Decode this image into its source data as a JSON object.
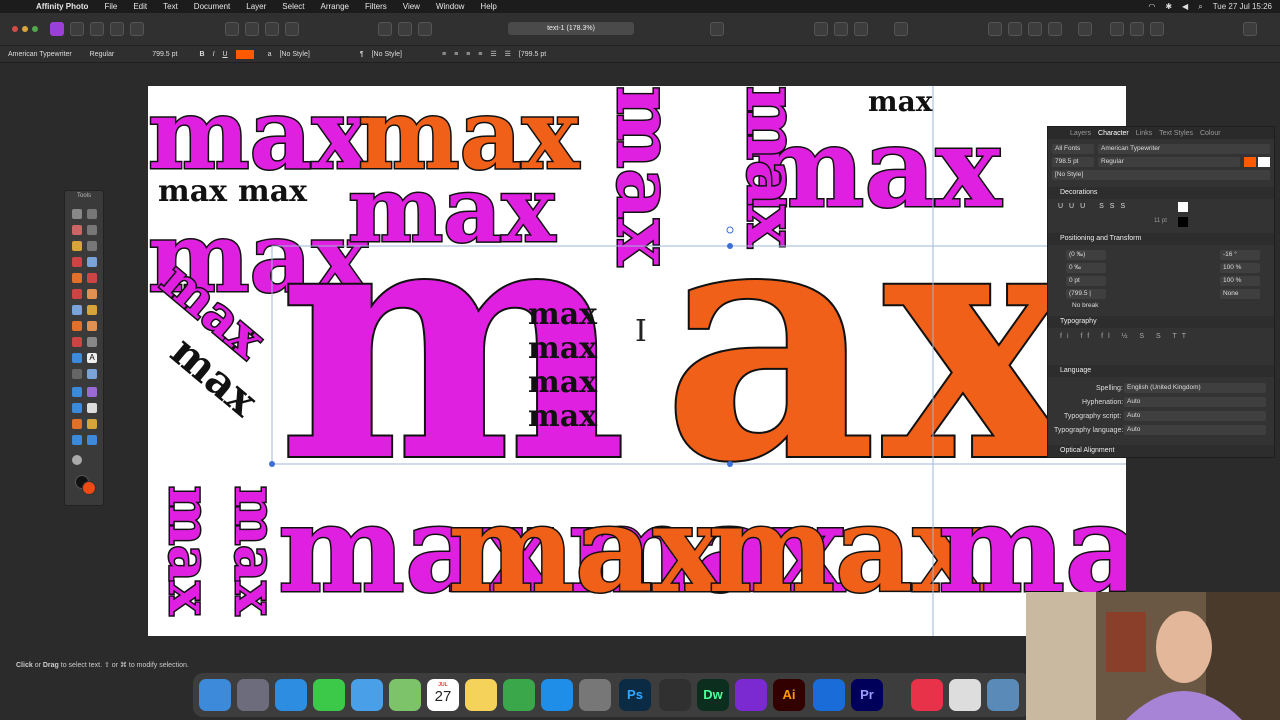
{
  "menubar": {
    "app_name": "Affinity Photo",
    "items": [
      "File",
      "Edit",
      "Text",
      "Document",
      "Layer",
      "Select",
      "Arrange",
      "Filters",
      "View",
      "Window",
      "Help"
    ],
    "clock": "Tue 27 Jul  15:26"
  },
  "toolbar": {
    "doc_title": "text-1 (178.3%)"
  },
  "context_bar": {
    "font": "American Typewriter",
    "weight": "Regular",
    "size": "799.5 pt",
    "bold": "B",
    "italic": "I",
    "underline": "U",
    "para_style": "[No Style]",
    "char_style": "[No Style]",
    "leading_size": "[799.5 pt",
    "fill_color": "#ff5a00"
  },
  "tools_panel": {
    "title": "Tools"
  },
  "canvas": {
    "word": "max",
    "colors": {
      "magenta": "#e020e0",
      "orange": "#f06018",
      "black": "#111111"
    }
  },
  "character_panel": {
    "tabs": [
      "Layers",
      "Character",
      "Links",
      "Text Styles",
      "Colour"
    ],
    "active_tab": "Character",
    "font_collection": "All Fonts",
    "font": "American Typewriter",
    "size": "798.5 pt",
    "weight": "Regular",
    "style": "[No Style]",
    "sections": {
      "decorations": "Decorations",
      "positioning": "Positioning and Transform",
      "typography": "Typography",
      "language": "Language",
      "optical": "Optical Alignment"
    },
    "decor_size": "11 pt",
    "pos": {
      "kerning": "(0 ‰)",
      "tracking": "0 ‰",
      "baseline": "0 pt",
      "leading": "(799.5 |",
      "shear": "-16 °",
      "height": "100 %",
      "width": "100 %",
      "caps": "None",
      "no_break": "No break"
    },
    "language": {
      "spelling_label": "Spelling:",
      "spelling": "English (United Kingdom)",
      "hyphenation_label": "Hyphenation:",
      "hyphenation": "Auto",
      "script_label": "Typography script:",
      "script": "Auto",
      "lang_label": "Typography language:",
      "lang": "Auto"
    }
  },
  "statusbar": {
    "click": "Click",
    "or1": "or",
    "drag": "Drag",
    "rest": " to select text. ⇧ or ⌘ to modify selection."
  },
  "dock": {
    "calendar_month": "JUL",
    "calendar_day": "27",
    "apps": [
      "Finder",
      "Launchpad",
      "Safari",
      "Messages",
      "Mail",
      "Maps",
      "Calendar",
      "Notes",
      "Numbers",
      "App Store",
      "System Preferences",
      "Ps",
      "OBS",
      "Dw",
      "Affinity Photo",
      "Ai",
      "Affinity Designer",
      "Pr",
      "Creative Cloud",
      "Preview",
      "Photo Viewer"
    ]
  }
}
